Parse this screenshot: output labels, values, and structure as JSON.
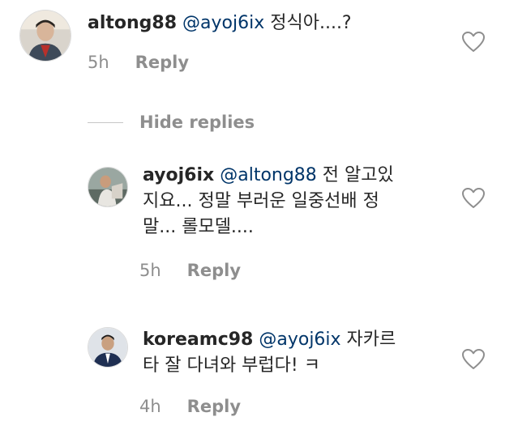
{
  "comments": [
    {
      "username": "altong88",
      "mention": "@ayoj6ix",
      "lines": [
        " 정식아....?"
      ],
      "time": "5h",
      "reply_label": "Reply"
    }
  ],
  "hide_replies_label": "Hide replies",
  "replies": [
    {
      "username": "ayoj6ix",
      "mention": "@altong88",
      "lines": [
        " 전 알고있",
        "지요... 정말 부러운 일중선배 정",
        "말... 롤모델...."
      ],
      "time": "5h",
      "reply_label": "Reply"
    },
    {
      "username": "koreamc98",
      "mention": "@ayoj6ix",
      "lines": [
        " 자카르",
        "타 잘 다녀와 부럽다! ㅋ"
      ],
      "time": "4h",
      "reply_label": "Reply"
    }
  ],
  "icons": {
    "like": "heart-outline-icon",
    "avatar": "user-avatar"
  },
  "colors": {
    "mention": "#003569",
    "meta": "#8e8e8e",
    "text": "#262626"
  }
}
